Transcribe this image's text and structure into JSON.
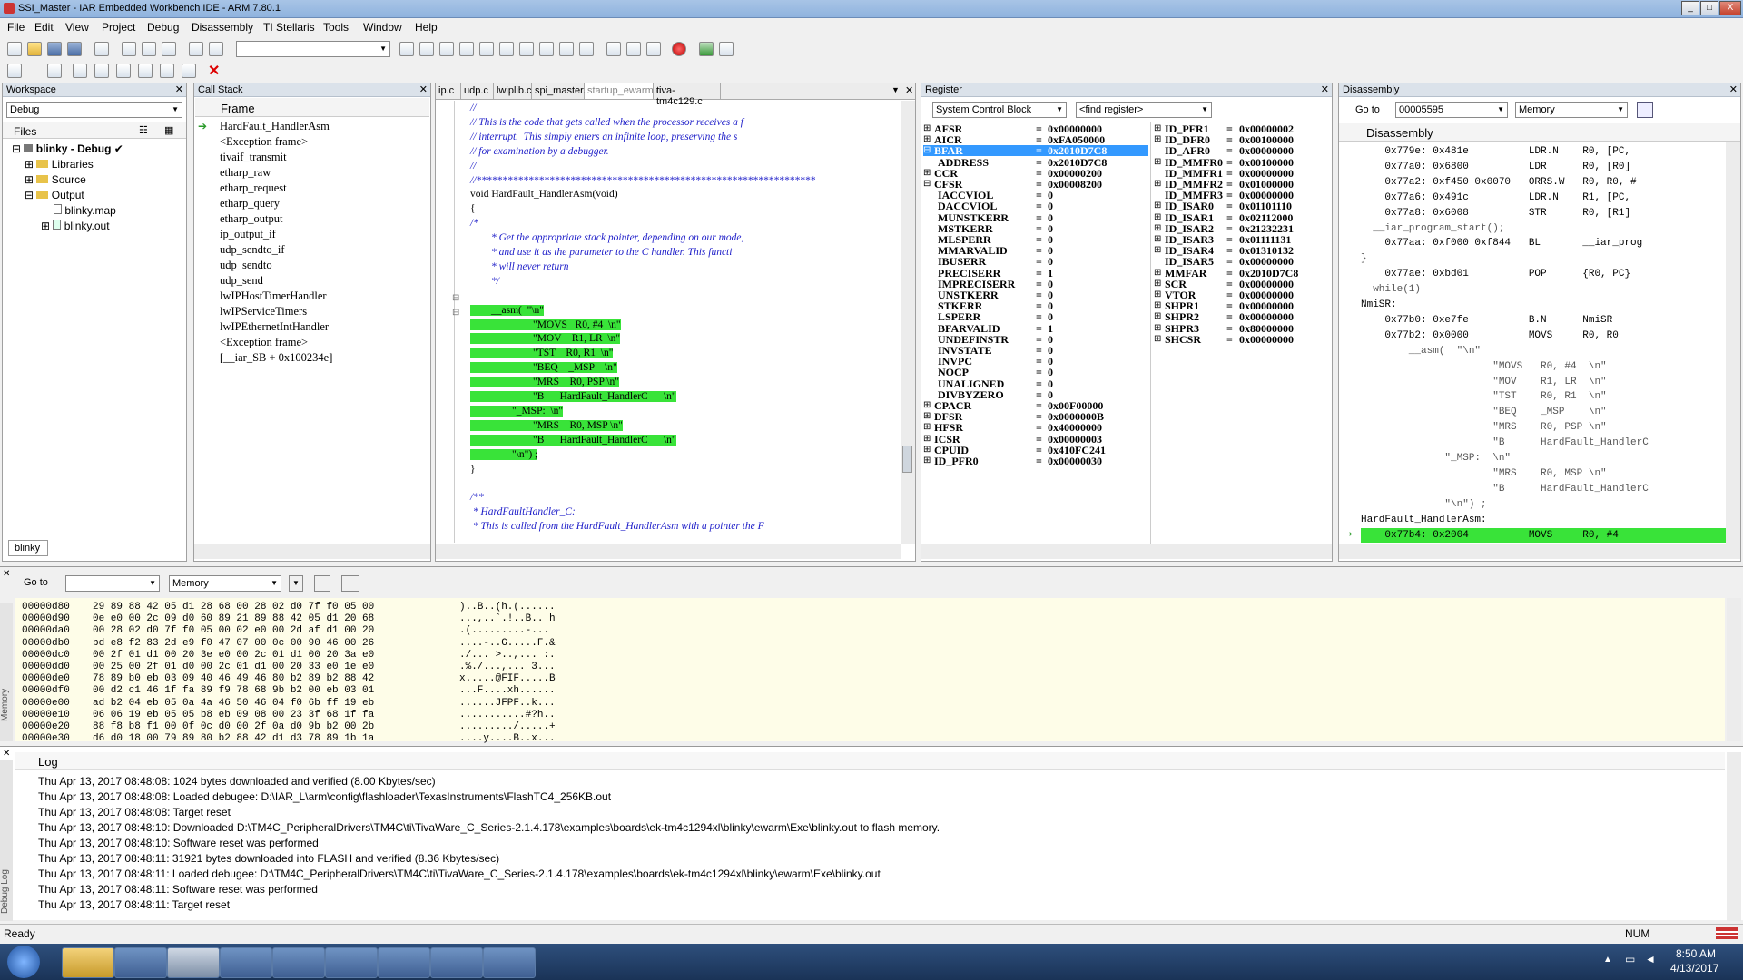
{
  "window": {
    "title": "SSI_Master - IAR Embedded Workbench IDE - ARM 7.80.1",
    "min": "_",
    "max": "□",
    "close": "X"
  },
  "menu": [
    "File",
    "Edit",
    "View",
    "Project",
    "Debug",
    "Disassembly",
    "TI Stellaris",
    "Tools",
    "Window",
    "Help"
  ],
  "workspace": {
    "title": "Workspace",
    "config": "Debug",
    "files_label": "Files",
    "tab": "blinky",
    "tree": [
      {
        "label": "blinky - Debug",
        "check": "✔"
      },
      {
        "label": "Libraries"
      },
      {
        "label": "Source"
      },
      {
        "label": "Output"
      },
      {
        "label": "blinky.map"
      },
      {
        "label": "blinky.out"
      }
    ]
  },
  "callstack": {
    "title": "Call Stack",
    "header": "Frame",
    "frames": [
      "HardFault_HandlerAsm",
      "<Exception frame>",
      "tivaif_transmit",
      "etharp_raw",
      "etharp_request",
      "etharp_query",
      "etharp_output",
      "ip_output_if",
      "udp_sendto_if",
      "udp_sendto",
      "udp_send",
      "lwIPHostTimerHandler",
      "lwIPServiceTimers",
      "lwIPEthernetIntHandler",
      "<Exception frame>",
      "[__iar_SB + 0x100234e]"
    ]
  },
  "editor": {
    "tabs": [
      "ip.c",
      "udp.c",
      "lwiplib.c",
      "spi_master.c",
      "startup_ewarm.c",
      "tiva-tm4c129.c"
    ],
    "active_tab": "startup_ewarm.c",
    "lines": [
      {
        "t": "//",
        "c": "comment"
      },
      {
        "t": "// This is the code that gets called when the processor receives a f",
        "c": "comment"
      },
      {
        "t": "// interrupt.  This simply enters an infinite loop, preserving the s",
        "c": "comment"
      },
      {
        "t": "// for examination by a debugger.",
        "c": "comment"
      },
      {
        "t": "//",
        "c": "comment"
      },
      {
        "t": "//*****************************************************************",
        "c": "comment"
      },
      {
        "t": "void HardFault_HandlerAsm(void)",
        "c": "code"
      },
      {
        "t": "{",
        "c": "code"
      },
      {
        "t": "/*",
        "c": "comment"
      },
      {
        "t": "        * Get the appropriate stack pointer, depending on our mode,",
        "c": "comment"
      },
      {
        "t": "        * and use it as the parameter to the C handler. This functi",
        "c": "comment"
      },
      {
        "t": "        * will never return",
        "c": "comment"
      },
      {
        "t": "        */",
        "c": "comment"
      },
      {
        "t": "",
        "c": "code"
      },
      {
        "t": "        __asm(  \"\\n\"",
        "c": "hl"
      },
      {
        "t": "                        \"MOVS   R0, #4  \\n\"",
        "c": "hl"
      },
      {
        "t": "                        \"MOV    R1, LR  \\n\"",
        "c": "hl"
      },
      {
        "t": "                        \"TST    R0, R1  \\n\"",
        "c": "hl"
      },
      {
        "t": "                        \"BEQ    _MSP    \\n\"",
        "c": "hl"
      },
      {
        "t": "                        \"MRS    R0, PSP \\n\"",
        "c": "hl"
      },
      {
        "t": "                        \"B      HardFault_HandlerC      \\n\"",
        "c": "hl"
      },
      {
        "t": "                \"_MSP:  \\n\"",
        "c": "hl"
      },
      {
        "t": "                        \"MRS    R0, MSP \\n\"",
        "c": "hl"
      },
      {
        "t": "                        \"B      HardFault_HandlerC      \\n\"",
        "c": "hl"
      },
      {
        "t": "                \"\\n\") ;",
        "c": "hl"
      },
      {
        "t": "}",
        "c": "code"
      },
      {
        "t": "",
        "c": "code"
      },
      {
        "t": "/**",
        "c": "comment"
      },
      {
        "t": " * HardFaultHandler_C:",
        "c": "comment"
      },
      {
        "t": " * This is called from the HardFault_HandlerAsm with a pointer the F",
        "c": "comment"
      }
    ]
  },
  "register": {
    "title": "Register",
    "group": "System Control Block",
    "find": "<find register>",
    "left": [
      {
        "n": "AFSR",
        "v": "0x00000000",
        "e": "+"
      },
      {
        "n": "AICR",
        "v": "0xFA050000",
        "e": "+"
      },
      {
        "n": "BFAR",
        "v": "0x2010D7C8",
        "e": "-",
        "sel": true
      },
      {
        "n": "ADDRESS",
        "v": "0x2010D7C8",
        "e": "",
        "i": 1
      },
      {
        "n": "CCR",
        "v": "0x00000200",
        "e": "+"
      },
      {
        "n": "CFSR",
        "v": "0x00008200",
        "e": "-"
      },
      {
        "n": "IACCVIOL",
        "v": "0",
        "e": "",
        "i": 1
      },
      {
        "n": "DACCVIOL",
        "v": "0",
        "e": "",
        "i": 1
      },
      {
        "n": "MUNSTKERR",
        "v": "0",
        "e": "",
        "i": 1
      },
      {
        "n": "MSTKERR",
        "v": "0",
        "e": "",
        "i": 1
      },
      {
        "n": "MLSPERR",
        "v": "0",
        "e": "",
        "i": 1
      },
      {
        "n": "MMARVALID",
        "v": "0",
        "e": "",
        "i": 1
      },
      {
        "n": "IBUSERR",
        "v": "0",
        "e": "",
        "i": 1
      },
      {
        "n": "PRECISERR",
        "v": "1",
        "e": "",
        "i": 1
      },
      {
        "n": "IMPRECISERR",
        "v": "0",
        "e": "",
        "i": 1
      },
      {
        "n": "UNSTKERR",
        "v": "0",
        "e": "",
        "i": 1
      },
      {
        "n": "STKERR",
        "v": "0",
        "e": "",
        "i": 1
      },
      {
        "n": "LSPERR",
        "v": "0",
        "e": "",
        "i": 1
      },
      {
        "n": "BFARVALID",
        "v": "1",
        "e": "",
        "i": 1
      },
      {
        "n": "UNDEFINSTR",
        "v": "0",
        "e": "",
        "i": 1
      },
      {
        "n": "INVSTATE",
        "v": "0",
        "e": "",
        "i": 1
      },
      {
        "n": "INVPC",
        "v": "0",
        "e": "",
        "i": 1
      },
      {
        "n": "NOCP",
        "v": "0",
        "e": "",
        "i": 1
      },
      {
        "n": "UNALIGNED",
        "v": "0",
        "e": "",
        "i": 1
      },
      {
        "n": "DIVBYZERO",
        "v": "0",
        "e": "",
        "i": 1
      },
      {
        "n": "CPACR",
        "v": "0x00F00000",
        "e": "+"
      },
      {
        "n": "DFSR",
        "v": "0x0000000B",
        "e": "+"
      },
      {
        "n": "HFSR",
        "v": "0x40000000",
        "e": "+"
      },
      {
        "n": "ICSR",
        "v": "0x00000003",
        "e": "+"
      },
      {
        "n": "CPUID",
        "v": "0x410FC241",
        "e": "+"
      },
      {
        "n": "ID_PFR0",
        "v": "0x00000030",
        "e": "+"
      }
    ],
    "right": [
      {
        "n": "ID_PFR1",
        "v": "0x00000002",
        "e": "+"
      },
      {
        "n": "ID_DFR0",
        "v": "0x00100000",
        "e": "+"
      },
      {
        "n": "ID_AFR0",
        "v": "0x00000000",
        "e": ""
      },
      {
        "n": "ID_MMFR0",
        "v": "0x00100000",
        "e": "+"
      },
      {
        "n": "ID_MMFR1",
        "v": "0x00000000",
        "e": ""
      },
      {
        "n": "ID_MMFR2",
        "v": "0x01000000",
        "e": "+"
      },
      {
        "n": "ID_MMFR3",
        "v": "0x00000000",
        "e": ""
      },
      {
        "n": "ID_ISAR0",
        "v": "0x01101110",
        "e": "+"
      },
      {
        "n": "ID_ISAR1",
        "v": "0x02112000",
        "e": "+"
      },
      {
        "n": "ID_ISAR2",
        "v": "0x21232231",
        "e": "+"
      },
      {
        "n": "ID_ISAR3",
        "v": "0x01111131",
        "e": "+"
      },
      {
        "n": "ID_ISAR4",
        "v": "0x01310132",
        "e": "+"
      },
      {
        "n": "ID_ISAR5",
        "v": "0x00000000",
        "e": ""
      },
      {
        "n": "MMFAR",
        "v": "0x2010D7C8",
        "e": "+"
      },
      {
        "n": "SCR",
        "v": "0x00000000",
        "e": "+"
      },
      {
        "n": "VTOR",
        "v": "0x00000000",
        "e": "+"
      },
      {
        "n": "SHPR1",
        "v": "0x00000000",
        "e": "+"
      },
      {
        "n": "SHPR2",
        "v": "0x00000000",
        "e": "+"
      },
      {
        "n": "SHPR3",
        "v": "0x80000000",
        "e": "+"
      },
      {
        "n": "SHCSR",
        "v": "0x00000000",
        "e": "+"
      }
    ]
  },
  "disassembly": {
    "title": "Disassembly",
    "goto_label": "Go to",
    "goto_value": "00005595",
    "mode": "Memory",
    "header": "Disassembly",
    "lines": [
      {
        "t": "    0x779e: 0x481e          LDR.N    R0, [PC,",
        "c": "n"
      },
      {
        "t": "    0x77a0: 0x6800          LDR      R0, [R0]",
        "c": "n"
      },
      {
        "t": "    0x77a2: 0xf450 0x0070   ORRS.W   R0, R0, #",
        "c": "n"
      },
      {
        "t": "    0x77a6: 0x491c          LDR.N    R1, [PC,",
        "c": "n"
      },
      {
        "t": "    0x77a8: 0x6008          STR      R0, [R1]",
        "c": "n"
      },
      {
        "t": "  __iar_program_start();",
        "c": "s"
      },
      {
        "t": "    0x77aa: 0xf000 0xf844   BL       __iar_prog",
        "c": "n"
      },
      {
        "t": "}",
        "c": "s"
      },
      {
        "t": "    0x77ae: 0xbd01          POP      {R0, PC}",
        "c": "n"
      },
      {
        "t": "  while(1)",
        "c": "s"
      },
      {
        "t": "NmiSR:",
        "c": "n"
      },
      {
        "t": "    0x77b0: 0xe7fe          B.N      NmiSR",
        "c": "n"
      },
      {
        "t": "    0x77b2: 0x0000          MOVS     R0, R0",
        "c": "n"
      },
      {
        "t": "        __asm(  \"\\n\"",
        "c": "s"
      },
      {
        "t": "                      \"MOVS   R0, #4  \\n\"",
        "c": "s"
      },
      {
        "t": "                      \"MOV    R1, LR  \\n\"",
        "c": "s"
      },
      {
        "t": "                      \"TST    R0, R1  \\n\"",
        "c": "s"
      },
      {
        "t": "                      \"BEQ    _MSP    \\n\"",
        "c": "s"
      },
      {
        "t": "                      \"MRS    R0, PSP \\n\"",
        "c": "s"
      },
      {
        "t": "                      \"B      HardFault_HandlerC",
        "c": "s"
      },
      {
        "t": "              \"_MSP:  \\n\"",
        "c": "s"
      },
      {
        "t": "                      \"MRS    R0, MSP \\n\"",
        "c": "s"
      },
      {
        "t": "                      \"B      HardFault_HandlerC",
        "c": "s"
      },
      {
        "t": "              \"\\n\") ;",
        "c": "s"
      },
      {
        "t": "HardFault_HandlerAsm:",
        "c": "n"
      },
      {
        "t": "    0x77b4: 0x2004          MOVS     R0, #4",
        "c": "cur"
      }
    ]
  },
  "memory": {
    "goto_label": "Go to",
    "mode": "Memory",
    "side_label": "Memory",
    "rows": [
      {
        "a": "00000d80",
        "h": "29 89 88 42 05 d1 28 68 00 28 02 d0 7f f0 05 00",
        "s": ")..B..(h.(......"
      },
      {
        "a": "00000d90",
        "h": "0e e0 00 2c 09 d0 60 89 21 89 88 42 05 d1 20 68",
        "s": "...,..`.!..B.. h"
      },
      {
        "a": "00000da0",
        "h": "00 28 02 d0 7f f0 05 00 02 e0 00 2d af d1 00 20",
        "s": ".(.........-... "
      },
      {
        "a": "00000db0",
        "h": "bd e8 f2 83 2d e9 f0 47 07 00 0c 00 90 46 00 26",
        "s": "....-..G.....F.&"
      },
      {
        "a": "00000dc0",
        "h": "00 2f 01 d1 00 20 3e e0 00 2c 01 d1 00 20 3a e0",
        "s": "./... >..,... :."
      },
      {
        "a": "00000dd0",
        "h": "00 25 00 2f 01 d0 00 2c 01 d1 00 20 33 e0 1e e0",
        "s": ".%./...,... 3..."
      },
      {
        "a": "00000de0",
        "h": "78 89 b0 eb 03 09 40 46 49 46 80 b2 89 b2 88 42",
        "s": "x.....@FIF.....B"
      },
      {
        "a": "00000df0",
        "h": "00 d2 c1 46 1f fa 89 f9 78 68 9b b2 00 eb 03 01",
        "s": "...F....xh......"
      },
      {
        "a": "00000e00",
        "h": "ad b2 04 eb 05 0a 4a 46 50 46 04 f0 6b ff 19 eb",
        "s": "......JFPF..k..."
      },
      {
        "a": "00000e10",
        "h": "06 06 19 eb 05 05 b8 eb 09 08 00 23 3f 68 1f fa",
        "s": "...........#?h.."
      },
      {
        "a": "00000e20",
        "h": "88 f8 b8 f1 00 0f 0c d0 00 2f 0a d0 9b b2 00 2b",
        "s": "........./.....+"
      },
      {
        "a": "00000e30",
        "h": "d6 d0 18 00 79 89 80 b2 88 42 d1 d3 78 89 1b 1a",
        "s": "....y....B..x..."
      }
    ]
  },
  "log": {
    "header": "Log",
    "side_label": "Debug Log",
    "entries": [
      "Thu Apr 13, 2017 08:48:08: 1024 bytes downloaded and verified (8.00 Kbytes/sec)",
      "Thu Apr 13, 2017 08:48:08: Loaded debugee: D:\\IAR_L\\arm\\config\\flashloader\\TexasInstruments\\FlashTC4_256KB.out",
      "Thu Apr 13, 2017 08:48:08: Target reset",
      "Thu Apr 13, 2017 08:48:10: Downloaded D:\\TM4C_PeripheralDrivers\\TM4C\\ti\\TivaWare_C_Series-2.1.4.178\\examples\\boards\\ek-tm4c1294xl\\blinky\\ewarm\\Exe\\blinky.out to flash memory.",
      "Thu Apr 13, 2017 08:48:10: Software reset was performed",
      "Thu Apr 13, 2017 08:48:11: 31921 bytes downloaded into FLASH and verified (8.36 Kbytes/sec)",
      "Thu Apr 13, 2017 08:48:11: Loaded debugee: D:\\TM4C_PeripheralDrivers\\TM4C\\ti\\TivaWare_C_Series-2.1.4.178\\examples\\boards\\ek-tm4c1294xl\\blinky\\ewarm\\Exe\\blinky.out",
      "Thu Apr 13, 2017 08:48:11: Software reset was performed",
      "Thu Apr 13, 2017 08:48:11: Target reset"
    ]
  },
  "status": {
    "left": "Ready",
    "right": "NUM"
  },
  "taskbar": {
    "time": "8:50 AM",
    "date": "4/13/2017"
  },
  "colors": {
    "highlight": "#39e339",
    "selection": "#3399ff",
    "comment": "#1c1cc8",
    "editor_bg": "#fefde8"
  }
}
